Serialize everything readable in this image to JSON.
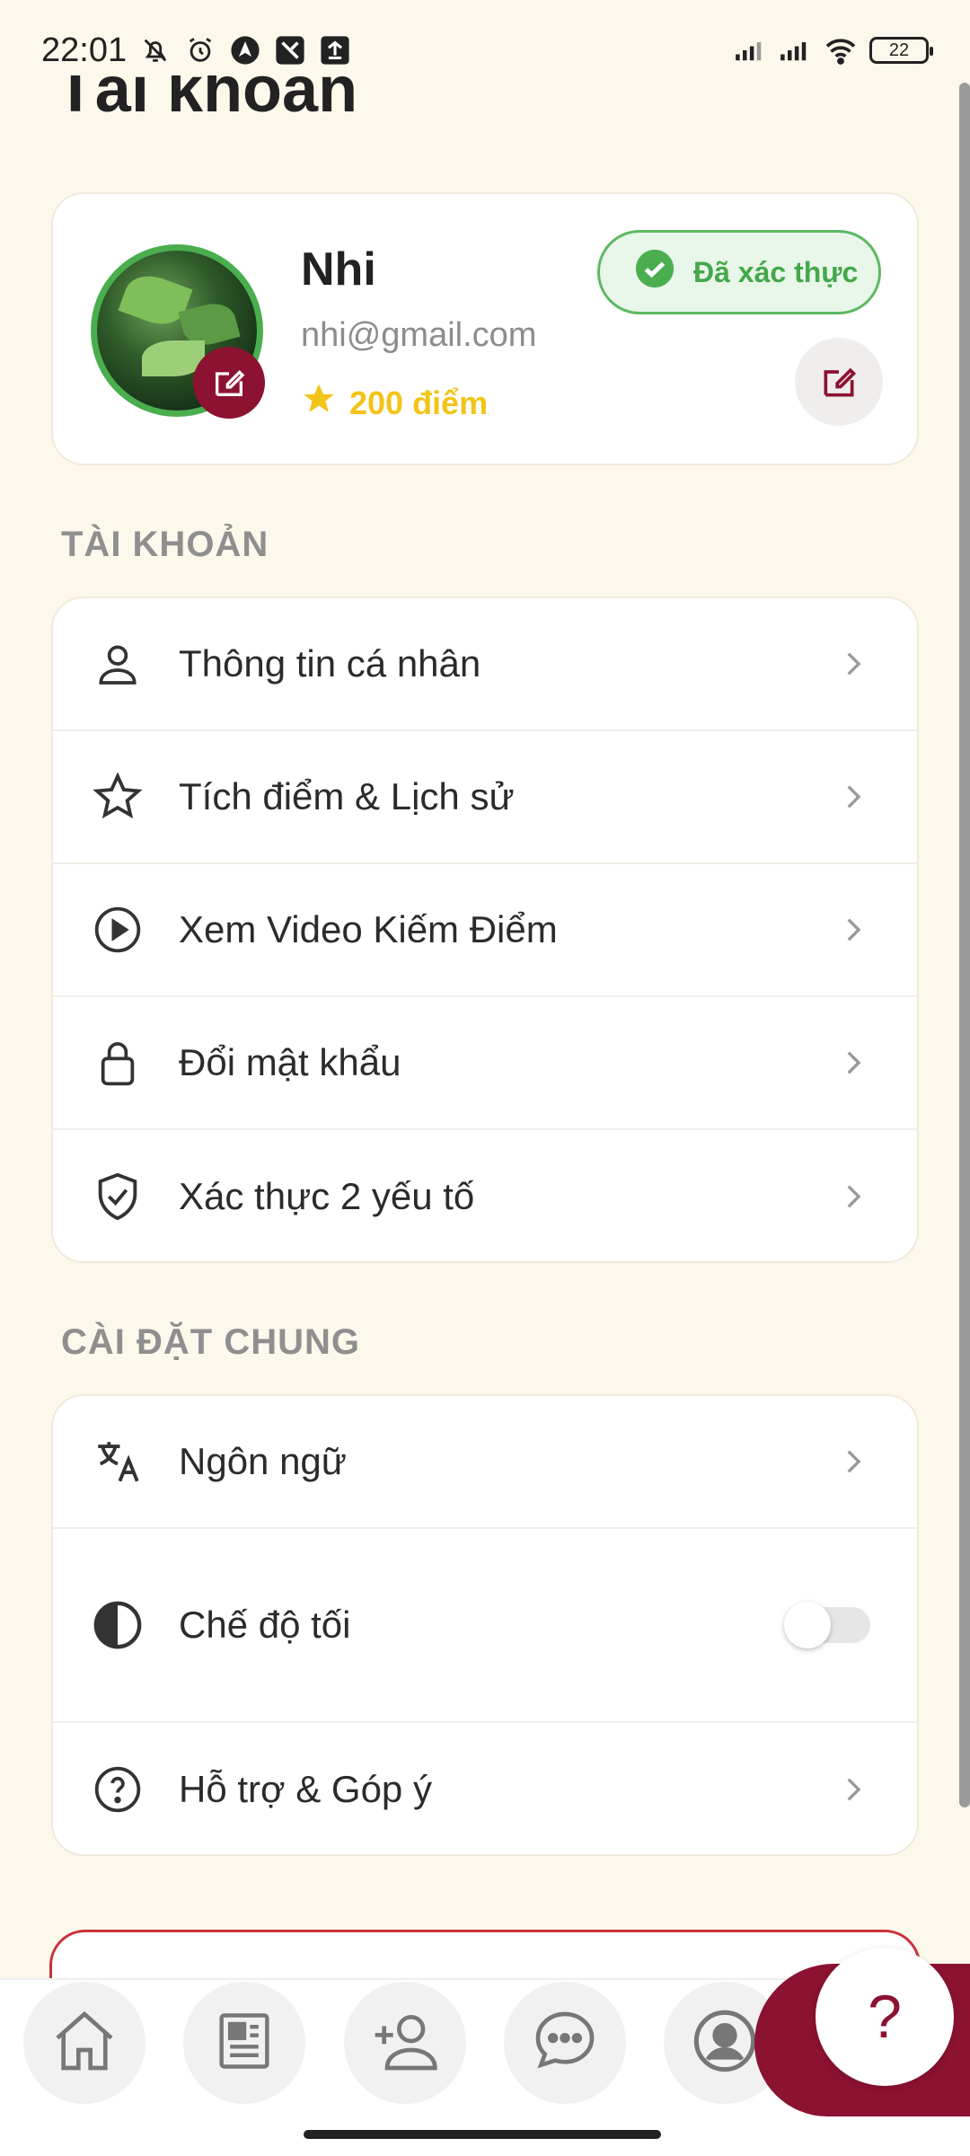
{
  "status_bar": {
    "time": "22:01",
    "battery": "22"
  },
  "header": {
    "title": "Tài khoản"
  },
  "profile": {
    "name": "Nhi",
    "email": "nhi@gmail.com",
    "points": "200 điểm",
    "verified_label": "Đã xác thực"
  },
  "account_section": {
    "title": "TÀI KHOẢN",
    "items": [
      {
        "label": "Thông tin cá nhân",
        "icon": "person-icon"
      },
      {
        "label": "Tích điểm & Lịch sử",
        "icon": "star-icon"
      },
      {
        "label": "Xem Video Kiếm Điểm",
        "icon": "play-circle-icon"
      },
      {
        "label": "Đổi mật khẩu",
        "icon": "lock-icon"
      },
      {
        "label": "Xác thực 2 yếu tố",
        "icon": "shield-check-icon"
      }
    ]
  },
  "settings_section": {
    "title": "CÀI ĐẶT CHUNG",
    "items": [
      {
        "label": "Ngôn ngữ",
        "icon": "translate-icon"
      },
      {
        "label": "Chế độ tối",
        "icon": "contrast-icon",
        "toggle": false
      },
      {
        "label": "Hỗ trợ & Góp ý",
        "icon": "help-circle-icon"
      }
    ]
  },
  "bottom_nav": {
    "items": [
      "home-icon",
      "news-icon",
      "add-friend-icon",
      "chat-icon",
      "profile-icon"
    ],
    "fab_label": "?"
  },
  "colors": {
    "accent": "#8c1231",
    "verified": "#4aae4f",
    "points": "#f2c418",
    "background": "#fdf8ec"
  }
}
